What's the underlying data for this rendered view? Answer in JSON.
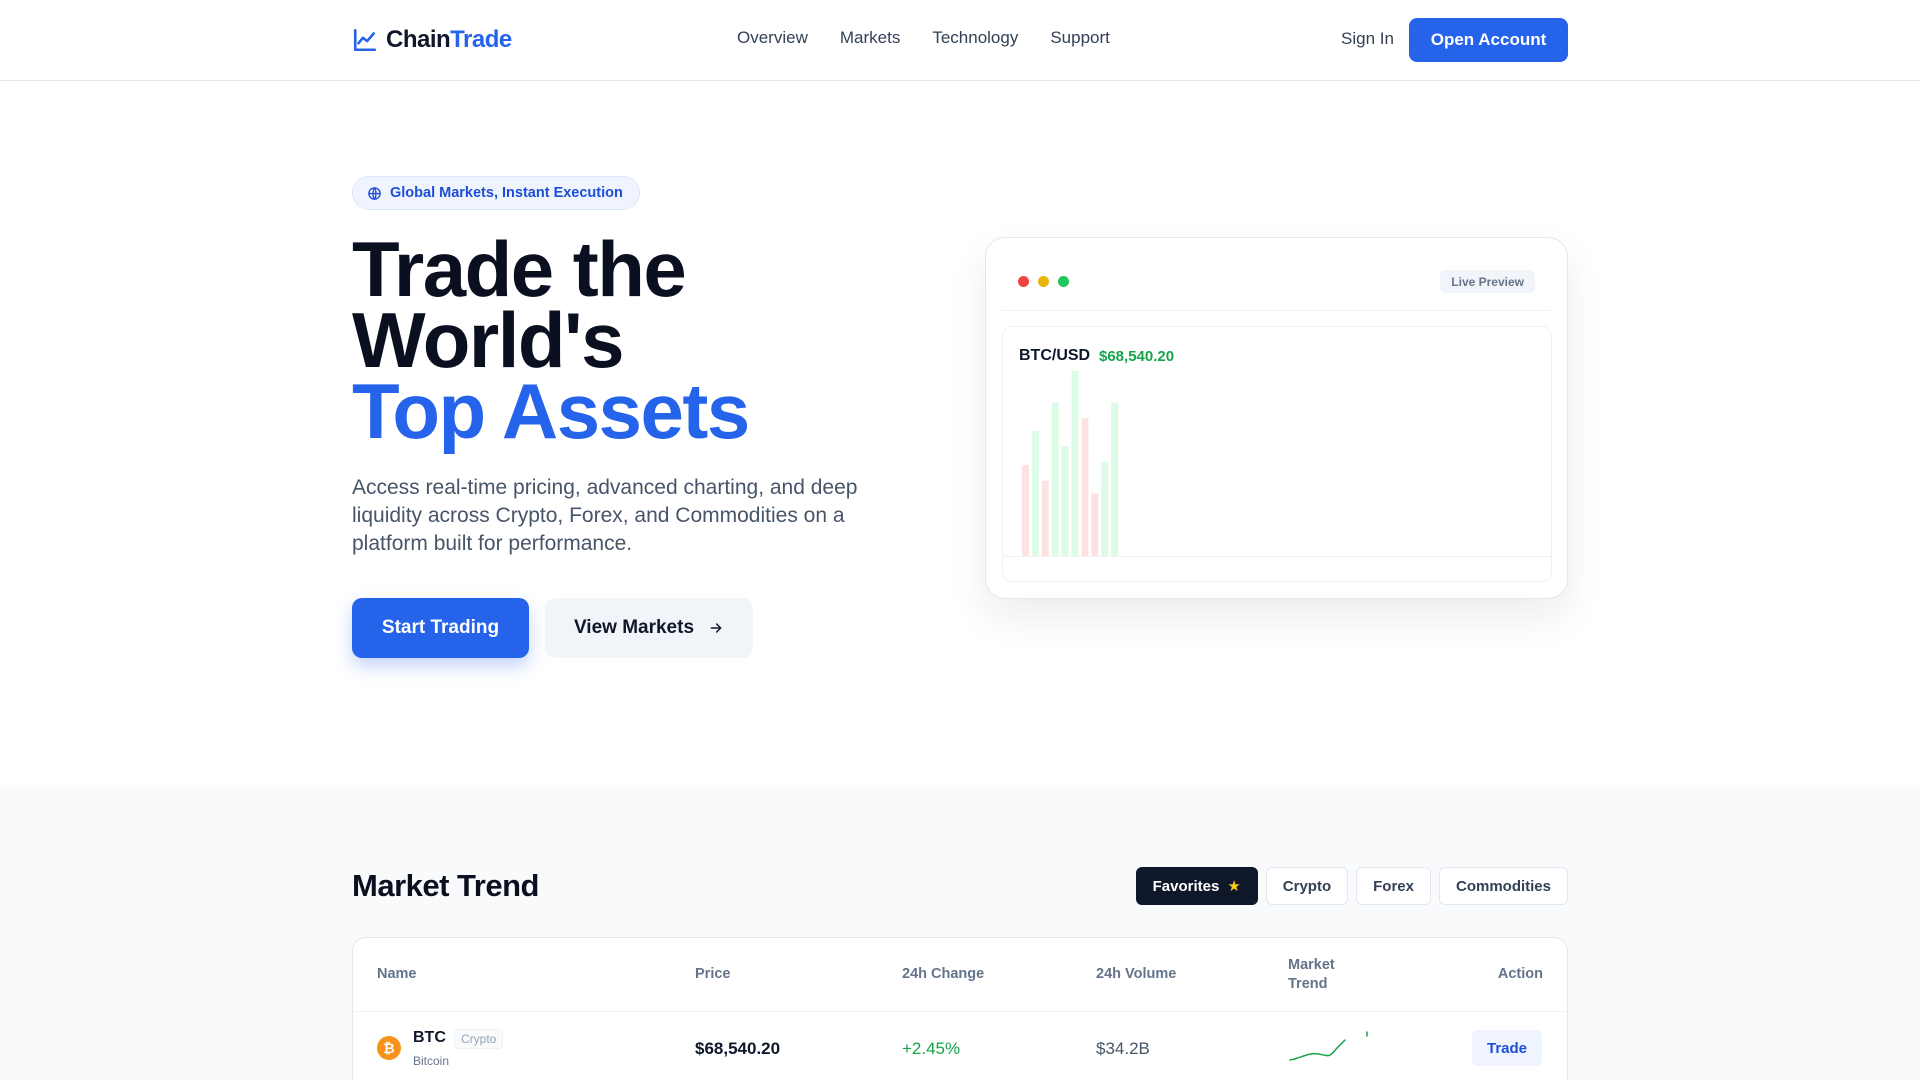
{
  "nav": {
    "logo_part1": "Chain",
    "logo_part2": "Trade",
    "links": [
      "Overview",
      "Markets",
      "Technology",
      "Support"
    ],
    "sign_in": "Sign In",
    "open_account": "Open Account"
  },
  "hero": {
    "badge": "Global Markets, Instant Execution",
    "title_line1": "Trade the",
    "title_line2": "World's",
    "title_accent": "Top Assets",
    "description": "Access real-time pricing, advanced charting, and deep liquidity across Crypto, Forex, and Commodities on a platform built for performance.",
    "primary_button": "Start Trading",
    "secondary_button": "View Markets"
  },
  "preview": {
    "live_label": "Live Preview",
    "pair": "BTC/USD",
    "price": "$68,540.20",
    "colors": {
      "up": "#dcfce7",
      "down": "#fee2e2"
    }
  },
  "chart_data": {
    "type": "bar",
    "series": [
      {
        "values": [
          58,
          80,
          48,
          98,
          70,
          118,
          88,
          40,
          60,
          98
        ],
        "direction": [
          "down",
          "up",
          "down",
          "up",
          "up",
          "up",
          "down",
          "down",
          "up",
          "up"
        ]
      }
    ],
    "ylim": [
      0,
      120
    ]
  },
  "market": {
    "title": "Market Trend",
    "tabs": [
      "Favorites",
      "Crypto",
      "Forex",
      "Commodities"
    ],
    "active_tab": "Favorites",
    "columns": [
      "Name",
      "Price",
      "24h Change",
      "24h Volume",
      "Market Trend",
      "Action"
    ],
    "rows": [
      {
        "symbol": "BTC",
        "icon": "bitcoin-icon",
        "icon_glyph": "₿",
        "category": "Crypto",
        "name": "Bitcoin",
        "price": "$68,540.20",
        "change": "+2.45%",
        "volume": "$34.2B",
        "action": "Trade"
      }
    ]
  },
  "colors": {
    "accent": "#2563eb",
    "positive": "#16a34a",
    "dark": "#0f172a"
  }
}
